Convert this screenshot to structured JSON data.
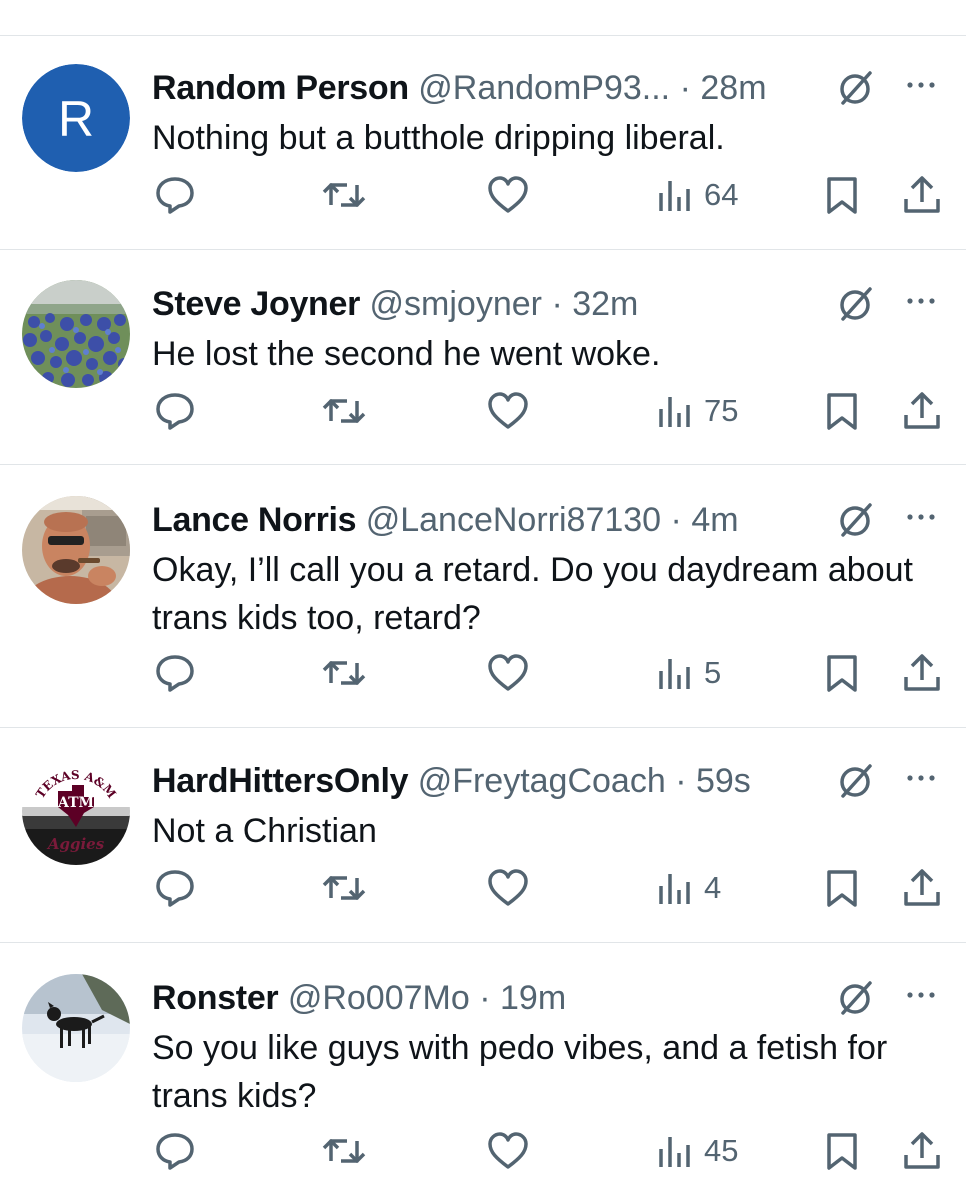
{
  "colors": {
    "text_primary": "#0f1419",
    "text_secondary": "#536471",
    "divider": "#e1e5e8",
    "avatar_blue": "#1f5fb0"
  },
  "icons": {
    "reply": "speech-bubble-icon",
    "retweet": "retweet-arrows-icon",
    "like": "heart-icon",
    "views": "bar-chart-icon",
    "bookmark": "bookmark-icon",
    "share": "share-upload-icon",
    "grok": "slashed-circle-icon",
    "more": "ellipsis-icon"
  },
  "tweets": [
    {
      "avatar_initial": "R",
      "avatar_type": "letter",
      "name": "Random Person",
      "handle": "@RandomP93...",
      "dot": "·",
      "time": "28m",
      "text": "Nothing but a butthole dripping liberal.",
      "views": "64"
    },
    {
      "avatar_type": "bluebonnets-photo",
      "name": "Steve Joyner",
      "handle": "@smjoyner",
      "dot": "·",
      "time": "32m",
      "text": "He lost the second he went woke.",
      "views": "75"
    },
    {
      "avatar_type": "man-sunglasses-photo",
      "name": "Lance Norris",
      "handle": "@LanceNorri87130",
      "dot": "·",
      "time": "4m",
      "text": "Okay, I’ll call you a retard.  Do you daydream about trans kids too, retard?",
      "views": "5"
    },
    {
      "avatar_type": "texas-am-logo",
      "avatar_logo_top": "TEXAS A&M",
      "avatar_logo_mid": "ATM",
      "avatar_logo_bottom": "Aggies",
      "name": "HardHittersOnly",
      "handle": "@FreytagCoach",
      "dot": "·",
      "time": "59s",
      "text": "Not a Christian",
      "views": "4"
    },
    {
      "avatar_type": "dog-snow-photo",
      "name": "Ronster",
      "handle": "@Ro007Mo",
      "dot": "·",
      "time": "19m",
      "text": "So you like guys with pedo vibes, and a fetish for trans kids?",
      "views": "45"
    }
  ]
}
